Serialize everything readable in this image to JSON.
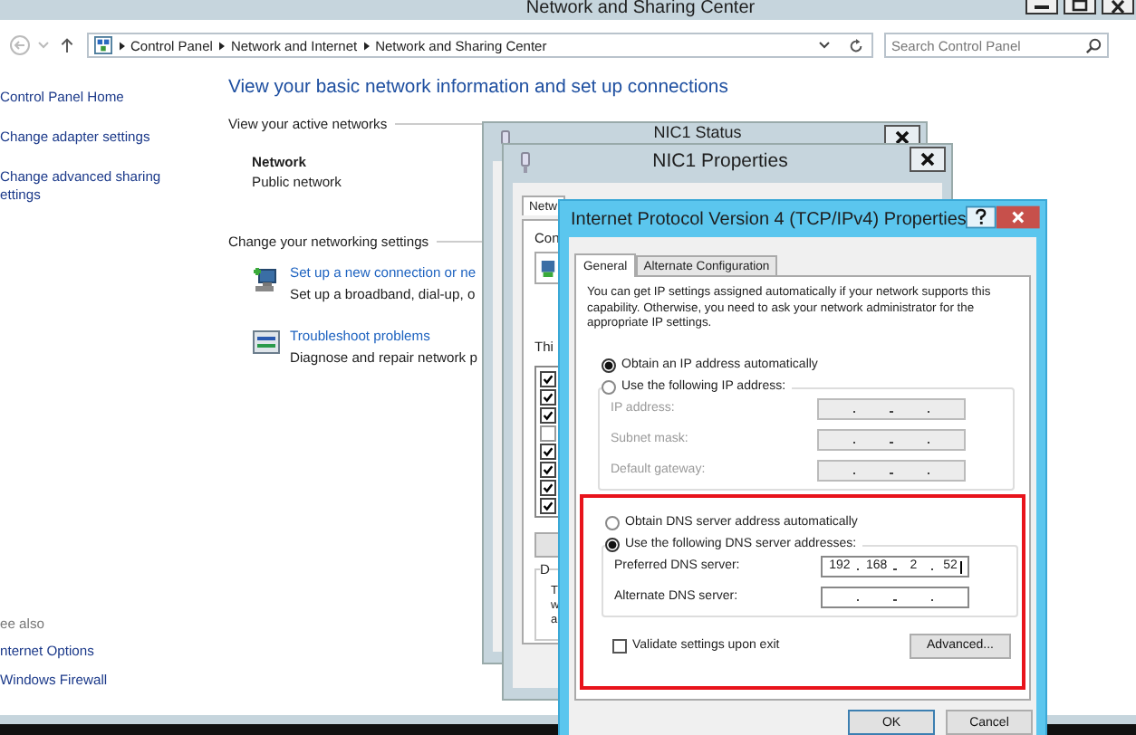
{
  "main_window": {
    "title": "Network and Sharing Center",
    "address_bar": {
      "crumbs": [
        "Control Panel",
        "Network and Internet",
        "Network and Sharing Center"
      ]
    },
    "search": {
      "placeholder": "Search Control Panel"
    },
    "sidebar": {
      "links": [
        {
          "lines": [
            "Control Panel Home"
          ]
        },
        {
          "lines": [
            "Change adapter settings"
          ]
        },
        {
          "lines": [
            "Change advanced sharing",
            "ettings"
          ]
        }
      ],
      "see_also_heading": "ee also",
      "see_also_links": [
        "nternet Options",
        "Windows Firewall"
      ]
    },
    "content": {
      "heading": "View your basic network information and set up connections",
      "active_networks_label": "View your active networks",
      "network": {
        "name": "Network",
        "type": "Public network"
      },
      "settings_label": "Change your networking settings",
      "tasks": [
        {
          "kind": "connection",
          "title": "Set up a new connection or ne",
          "description": "Set up a broadband, dial-up, o"
        },
        {
          "kind": "troubleshoot",
          "title": "Troubleshoot problems",
          "description": "Diagnose and repair network p"
        }
      ]
    }
  },
  "status_window": {
    "title": "NIC1 Status"
  },
  "properties_window": {
    "title": "NIC1 Properties",
    "tab": "Netw",
    "connect_label": "Con",
    "items_label": "Thi",
    "items": [
      {
        "checked": true
      },
      {
        "checked": true
      },
      {
        "checked": true
      },
      {
        "checked": false
      },
      {
        "checked": true
      },
      {
        "checked": true
      },
      {
        "checked": true
      },
      {
        "checked": true
      }
    ],
    "description_label": "D",
    "description_lines": [
      "T",
      "w",
      "a"
    ]
  },
  "ipv4_window": {
    "title": "Internet Protocol Version 4 (TCP/IPv4) Properties",
    "tabs": [
      {
        "label": "General",
        "selected": true
      },
      {
        "label": "Alternate Configuration",
        "selected": false
      }
    ],
    "intro": "You can get IP settings assigned automatically if your network supports this capability. Otherwise, you need to ask your network administrator for the appropriate IP settings.",
    "ip_options": [
      {
        "label": "Obtain an IP address automatically",
        "selected": true
      },
      {
        "label": "Use the following IP address:",
        "selected": false
      }
    ],
    "ip_fields": [
      {
        "label": "IP address:",
        "disabled": true
      },
      {
        "label": "Subnet mask:",
        "disabled": true
      },
      {
        "label": "Default gateway:",
        "disabled": true
      }
    ],
    "dns_options": [
      {
        "label": "Obtain DNS server address automatically",
        "selected": false
      },
      {
        "label": "Use the following DNS server addresses:",
        "selected": true
      }
    ],
    "dns_fields": [
      {
        "label": "Preferred DNS server:",
        "disabled": false,
        "octets": [
          "192",
          "168",
          "2",
          "52"
        ]
      },
      {
        "label": "Alternate DNS server:",
        "disabled": false
      }
    ],
    "validate": {
      "label": "Validate settings upon exit",
      "checked": false
    },
    "advanced_button": "Advanced...",
    "buttons": [
      "OK",
      "Cancel"
    ]
  }
}
